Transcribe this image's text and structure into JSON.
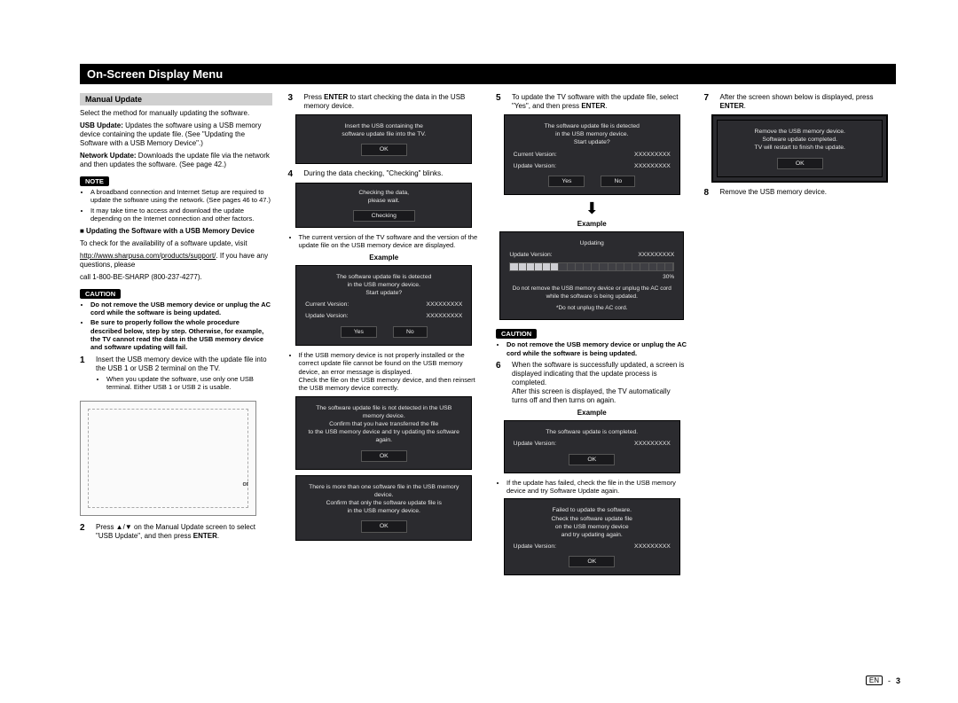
{
  "page": {
    "title": "On-Screen Display Menu",
    "footer_lang": "EN",
    "footer_sep": "-",
    "footer_page": "3"
  },
  "col1": {
    "section": "Manual Update",
    "intro": "Select the method for manually updating the software.",
    "usb_update_label": "USB Update:",
    "usb_update_body": " Updates the software using a USB memory device containing the update file. (See \"Updating the Software with a USB Memory Device\".)",
    "net_update_label": "Network Update:",
    "net_update_body": " Downloads the update file via the network and then updates the software. (See page 42.)",
    "note_pill": "NOTE",
    "notes": [
      "A broadband connection and Internet Setup are required to update the software using the network. (See pages 46 to 47.)",
      "It may take time to access and download the update depending on the Internet connection and other factors."
    ],
    "sub_head": "■ Updating the Software with a USB Memory Device",
    "sub_body1": "To check for the availability of a software update, visit",
    "sub_link": "http://www.sharpusa.com/products/support/",
    "sub_body2": ". If you have any questions, please",
    "sub_phone": "call 1-800-BE-SHARP (800-237-4277).",
    "caution_pill": "CAUTION",
    "cautions": [
      "Do not remove the USB memory device or unplug the AC cord while the software is being updated.",
      "Be sure to properly follow the whole procedure described below, step by step. Otherwise, for example, the TV cannot read the data in the USB memory device and software updating will fail."
    ],
    "step1_num": "1",
    "step1": "Insert the USB memory device with the update file into the USB 1 or USB 2 terminal on the TV.",
    "step1_sub": "When you update the software, use only one USB terminal. Either USB 1 or USB 2 is usable.",
    "fig_or": "or",
    "step2_num": "2",
    "step2_a": "Press ▲/▼ on the Manual Update screen to select \"USB Update\", and then press ",
    "step2_b": "ENTER",
    "step2_c": "."
  },
  "col2": {
    "step3_num": "3",
    "step3_a": "Press ",
    "step3_b": "ENTER",
    "step3_c": " to start checking the data in the USB memory device.",
    "osd3_l1": "Insert the USB containing the",
    "osd3_l2": "software update file into the TV.",
    "osd3_btn": "OK",
    "step4_num": "4",
    "step4": "During the data checking, \"Checking\" blinks.",
    "osd4a_l1": "Checking the data,",
    "osd4a_l2": "please wait.",
    "osd4a_l3": "Checking",
    "osd4b_bullet": "The current version of the TV software and the version of the update file on the USB memory device are displayed.",
    "example_label": "Example",
    "osd4b_l1": "The software update file is detected",
    "osd4b_l2": "in the USB memory device.",
    "osd4b_l3": "Start update?",
    "osd4b_row_l1": "Current Version:",
    "osd4b_row_r1": "XXXXXXXXX",
    "osd4b_row_l2": "Update Version:",
    "osd4b_row_r2": "XXXXXXXXX",
    "osd4b_btn_yes": "Yes",
    "osd4b_btn_no": "No",
    "osd4c_prefix": "If the USB memory device is not properly installed or the correct update file cannot be found on the USB memory device, an error message is displayed.",
    "osd4c_check": "Check the file on the USB memory device, and then reinsert the USB memory device correctly.",
    "osd4err1_l1": "The software update file is not detected in the USB memory device.",
    "osd4err1_l2": "Confirm that you have transferred the file",
    "osd4err1_l3": "to the USB memory device and try updating the software again.",
    "osd4err1_btn": "OK",
    "osd4err2_l1": "There is more than one software file in the USB memory device.",
    "osd4err2_l2": "Confirm that only the software update file is",
    "osd4err2_l3": "in the USB memory device.",
    "osd4err2_btn": "OK"
  },
  "col3": {
    "step5_num": "5",
    "step5_a": "To update the TV software with the update file, select \"Yes\", and then press ",
    "step5_b": "ENTER",
    "step5_c": ".",
    "osd5_l1": "The software update file is detected",
    "osd5_l2": "in the USB memory device.",
    "osd5_l3": "Start update?",
    "osd5_row_l1": "Current Version:",
    "osd5_row_r1": "XXXXXXXXX",
    "osd5_row_l2": "Update Version:",
    "osd5_row_r2": "XXXXXXXXX",
    "osd5_btn_yes": "Yes",
    "osd5_btn_no": "No",
    "arrow": "⬇",
    "example_label": "Example",
    "osd5b_l1": "Updating",
    "osd5b_row_l": "Update Version:",
    "osd5b_row_r": "XXXXXXXXX",
    "osd5b_pct": "30%",
    "osd5b_caution": "Do not remove the USB memory device or unplug the AC cord while the software is being updated.",
    "osd5b_caution2": "*Do not unplug the AC cord.",
    "caution_pill": "CAUTION",
    "caution_text": "Do not remove the USB memory device or unplug the AC cord while the software is being updated.",
    "step6_num": "6",
    "step6_a": "When the software is successfully updated, a screen is displayed indicating that the update process is completed.",
    "step6_b": "After this screen is displayed, the TV automatically turns off and then turns on again.",
    "osd6_l1": "The software update is completed.",
    "osd6_row_l": "Update Version:",
    "osd6_row_r": "XXXXXXXXX",
    "osd6_btn": "OK",
    "osd6_fail_bullet": "If the update has failed, check the file in the USB memory device and try Software Update again.",
    "osd6f_l1": "Failed to update the software.",
    "osd6f_l2": "Check the software update file",
    "osd6f_l3": "on the USB memory device",
    "osd6f_l4": "and try updating again.",
    "osd6f_row_l": "Update Version:",
    "osd6f_row_r": "XXXXXXXXX",
    "osd6f_btn": "OK"
  },
  "col4": {
    "step7_num": "7",
    "step7_a": "After the screen shown below is displayed, press ",
    "step7_b": "ENTER",
    "step7_c": ".",
    "osd7_l1": "Remove the USB memory device.",
    "osd7_l2": "Software update completed.",
    "osd7_l3": "TV will restart to finish the update.",
    "osd7_btn": "OK",
    "step8_num": "8",
    "step8": "Remove the USB memory device."
  }
}
